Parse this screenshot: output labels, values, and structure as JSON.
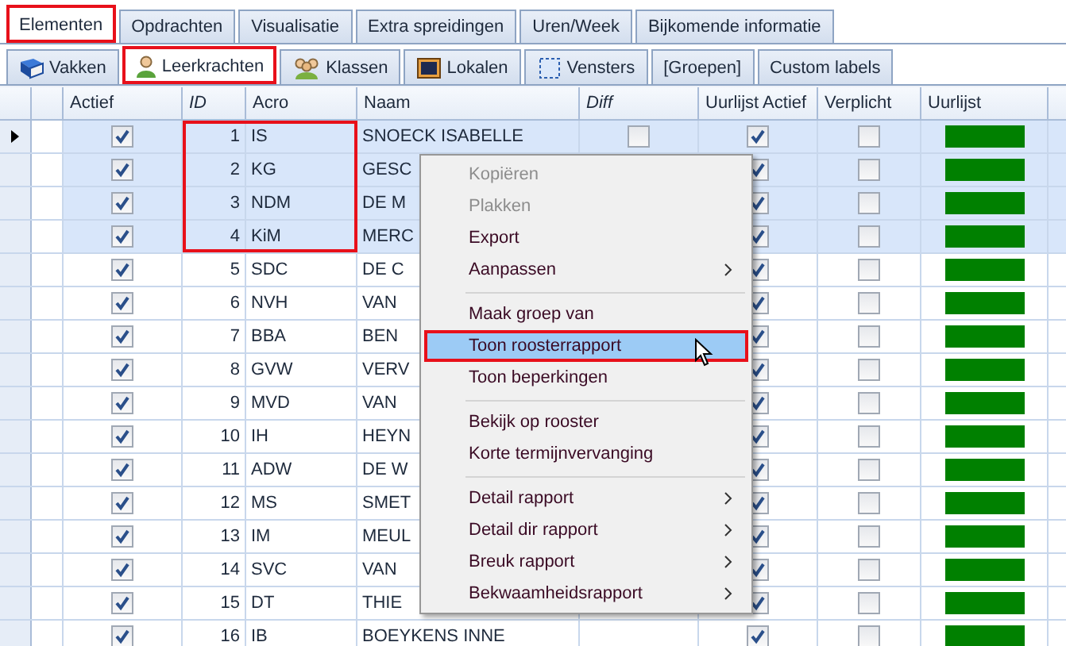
{
  "tabs": [
    {
      "label": "Elementen",
      "selected": true,
      "highlighted": true
    },
    {
      "label": "Opdrachten",
      "selected": false,
      "highlighted": false
    },
    {
      "label": "Visualisatie",
      "selected": false,
      "highlighted": false
    },
    {
      "label": "Extra spreidingen",
      "selected": false,
      "highlighted": false
    },
    {
      "label": "Uren/Week",
      "selected": false,
      "highlighted": false
    },
    {
      "label": "Bijkomende informatie",
      "selected": false,
      "highlighted": false
    }
  ],
  "subtabs": [
    {
      "label": "Vakken",
      "selected": false,
      "highlighted": false
    },
    {
      "label": "Leerkrachten",
      "selected": true,
      "highlighted": true
    },
    {
      "label": "Klassen",
      "selected": false,
      "highlighted": false
    },
    {
      "label": "Lokalen",
      "selected": false,
      "highlighted": false
    },
    {
      "label": "Vensters",
      "selected": false,
      "highlighted": false
    },
    {
      "label": "[Groepen]",
      "selected": false,
      "highlighted": false
    },
    {
      "label": "Custom labels",
      "selected": false,
      "highlighted": false
    }
  ],
  "grid": {
    "columns": [
      {
        "label": "Actief",
        "italic": false
      },
      {
        "label": "ID",
        "italic": true
      },
      {
        "label": "Acro",
        "italic": false
      },
      {
        "label": "Naam",
        "italic": false
      },
      {
        "label": "Diff",
        "italic": true
      },
      {
        "label": "Uurlijst Actief",
        "italic": false
      },
      {
        "label": "Verplicht",
        "italic": false
      },
      {
        "label": "Uurlijst",
        "italic": false
      }
    ],
    "rows": [
      {
        "current": true,
        "selected": true,
        "highlighted": true,
        "actief": true,
        "id": "1",
        "acro": "IS",
        "naam": "SNOECK ISABELLE",
        "diff": false,
        "uurlijst_actief": true,
        "verplicht": false,
        "color": "#008000"
      },
      {
        "current": false,
        "selected": true,
        "highlighted": true,
        "actief": true,
        "id": "2",
        "acro": "KG",
        "naam": "GESC",
        "uurlijst_actief": true,
        "verplicht": false,
        "color": "#008000"
      },
      {
        "current": false,
        "selected": true,
        "highlighted": true,
        "actief": true,
        "id": "3",
        "acro": "NDM",
        "naam": "DE M",
        "uurlijst_actief": true,
        "verplicht": false,
        "color": "#008000"
      },
      {
        "current": false,
        "selected": true,
        "highlighted": true,
        "actief": true,
        "id": "4",
        "acro": "KiM",
        "naam": "MERC",
        "uurlijst_actief": true,
        "verplicht": false,
        "color": "#008000"
      },
      {
        "current": false,
        "selected": false,
        "highlighted": false,
        "actief": true,
        "id": "5",
        "acro": "SDC",
        "naam": "DE C",
        "uurlijst_actief": true,
        "verplicht": false,
        "color": "#008000"
      },
      {
        "current": false,
        "selected": false,
        "highlighted": false,
        "actief": true,
        "id": "6",
        "acro": "NVH",
        "naam": "VAN",
        "uurlijst_actief": true,
        "verplicht": false,
        "color": "#008000"
      },
      {
        "current": false,
        "selected": false,
        "highlighted": false,
        "actief": true,
        "id": "7",
        "acro": "BBA",
        "naam": "BEN",
        "uurlijst_actief": true,
        "verplicht": false,
        "color": "#008000"
      },
      {
        "current": false,
        "selected": false,
        "highlighted": false,
        "actief": true,
        "id": "8",
        "acro": "GVW",
        "naam": "VERV",
        "uurlijst_actief": true,
        "verplicht": false,
        "color": "#008000"
      },
      {
        "current": false,
        "selected": false,
        "highlighted": false,
        "actief": true,
        "id": "9",
        "acro": "MVD",
        "naam": "VAN",
        "uurlijst_actief": true,
        "verplicht": false,
        "color": "#008000"
      },
      {
        "current": false,
        "selected": false,
        "highlighted": false,
        "actief": true,
        "id": "10",
        "acro": "IH",
        "naam": "HEYN",
        "uurlijst_actief": true,
        "verplicht": false,
        "color": "#008000"
      },
      {
        "current": false,
        "selected": false,
        "highlighted": false,
        "actief": true,
        "id": "11",
        "acro": "ADW",
        "naam": "DE W",
        "uurlijst_actief": true,
        "verplicht": false,
        "color": "#008000"
      },
      {
        "current": false,
        "selected": false,
        "highlighted": false,
        "actief": true,
        "id": "12",
        "acro": "MS",
        "naam": "SMET",
        "uurlijst_actief": true,
        "verplicht": false,
        "color": "#008000"
      },
      {
        "current": false,
        "selected": false,
        "highlighted": false,
        "actief": true,
        "id": "13",
        "acro": "IM",
        "naam": "MEUL",
        "uurlijst_actief": true,
        "verplicht": false,
        "color": "#008000"
      },
      {
        "current": false,
        "selected": false,
        "highlighted": false,
        "actief": true,
        "id": "14",
        "acro": "SVC",
        "naam": "VAN",
        "uurlijst_actief": true,
        "verplicht": false,
        "color": "#008000"
      },
      {
        "current": false,
        "selected": false,
        "highlighted": false,
        "actief": true,
        "id": "15",
        "acro": "DT",
        "naam": "THIE",
        "uurlijst_actief": true,
        "verplicht": false,
        "color": "#008000"
      },
      {
        "current": false,
        "selected": false,
        "highlighted": false,
        "actief": true,
        "id": "16",
        "acro": "IB",
        "naam": "BOEYKENS INNE",
        "uurlijst_actief": true,
        "verplicht": false,
        "color": "#008000"
      }
    ]
  },
  "context_menu": {
    "items": [
      {
        "kind": "item",
        "label": "Kopiëren",
        "disabled": true,
        "selected": false
      },
      {
        "kind": "item",
        "label": "Plakken",
        "disabled": true,
        "selected": false
      },
      {
        "kind": "item",
        "label": "Export",
        "disabled": false,
        "selected": false
      },
      {
        "kind": "submenu",
        "label": "Aanpassen",
        "disabled": false,
        "selected": false
      },
      {
        "kind": "separator"
      },
      {
        "kind": "item",
        "label": "Maak groep van",
        "disabled": false,
        "selected": false
      },
      {
        "kind": "item",
        "label": "Toon roosterrapport",
        "disabled": false,
        "selected": true
      },
      {
        "kind": "item",
        "label": "Toon beperkingen",
        "disabled": false,
        "selected": false
      },
      {
        "kind": "separator"
      },
      {
        "kind": "item",
        "label": "Bekijk op rooster",
        "disabled": false,
        "selected": false
      },
      {
        "kind": "item",
        "label": "Korte termijnvervanging",
        "disabled": false,
        "selected": false
      },
      {
        "kind": "separator"
      },
      {
        "kind": "submenu",
        "label": "Detail rapport",
        "disabled": false,
        "selected": false
      },
      {
        "kind": "submenu",
        "label": "Detail dir rapport",
        "disabled": false,
        "selected": false
      },
      {
        "kind": "submenu",
        "label": "Breuk rapport",
        "disabled": false,
        "selected": false
      },
      {
        "kind": "submenu",
        "label": "Bekwaamheidsrapport",
        "disabled": false,
        "selected": false
      }
    ]
  }
}
